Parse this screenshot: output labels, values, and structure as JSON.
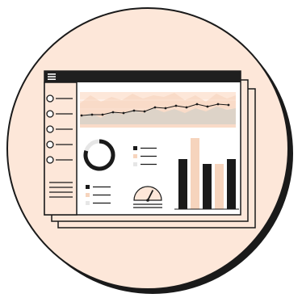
{
  "palette": {
    "background": "#ffffff",
    "circle_fill": "#fde7d9",
    "circle_shadow": "#1a1a1a",
    "stroke": "#1a1a1a",
    "panel": "#ffffff",
    "sidebar": "#fde7d9",
    "titlebar": "#1f1f1f",
    "area_light": "#fde7d9",
    "area_mid": "#ddd3c8",
    "accent_light": "#f6d4bd",
    "gray": "#e6e6e6"
  },
  "icons": {
    "menu": "hamburger-menu-icon",
    "gauge": "gauge-icon"
  },
  "sidebar": {
    "item_count": 5
  },
  "donut": {
    "dark_fraction": 0.8
  },
  "gauge": {
    "level_fraction": 0.65
  },
  "bar_chart": {
    "values": [
      0.62,
      0.88,
      0.56,
      0.56,
      0.62
    ],
    "colors": [
      "dark",
      "light",
      "dark",
      "light",
      "dark"
    ]
  }
}
